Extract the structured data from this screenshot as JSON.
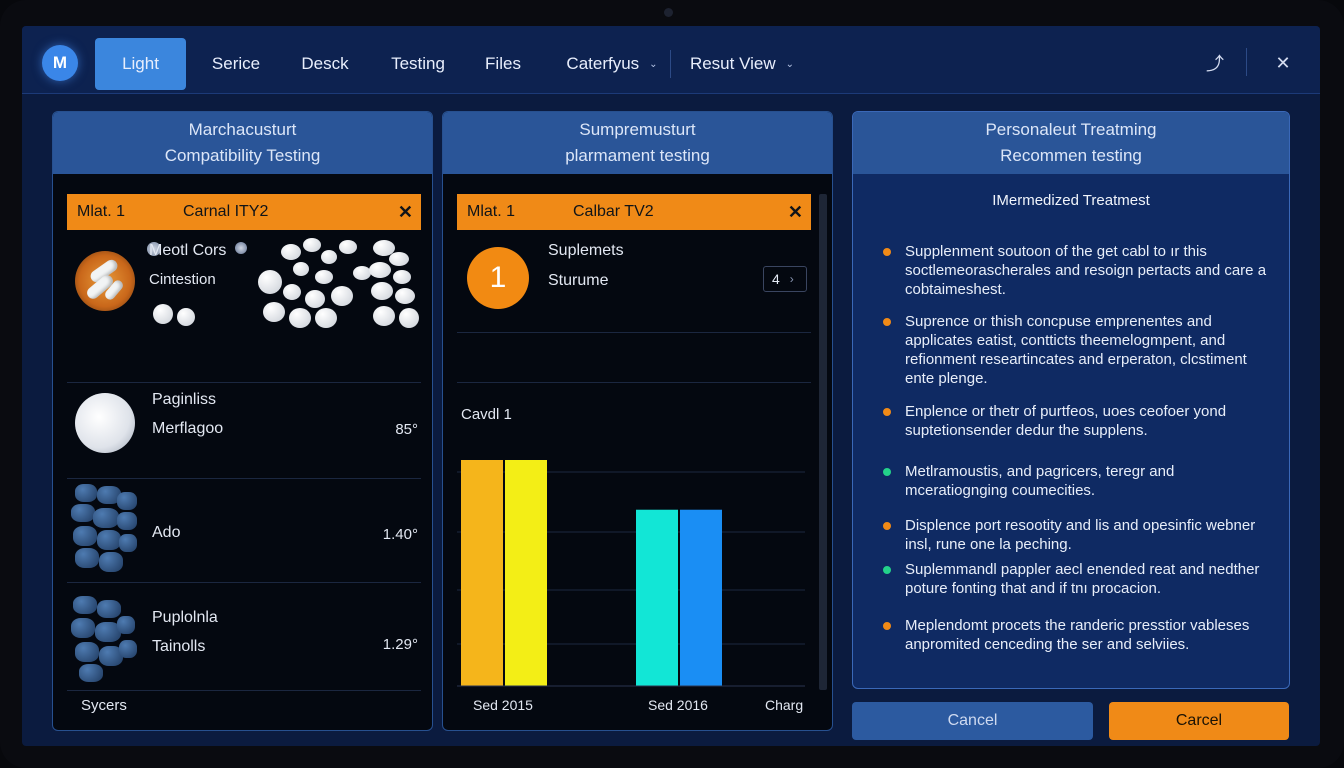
{
  "nav": {
    "logo": "M",
    "tabs": [
      {
        "label": "Light"
      },
      {
        "label": "Serice"
      },
      {
        "label": "Desck"
      },
      {
        "label": "Testing"
      },
      {
        "label": "Files"
      },
      {
        "label": "Caterfyus"
      },
      {
        "label": "Resut View"
      }
    ],
    "pin_icon": "pin-icon",
    "close_icon": "close-icon"
  },
  "panel1": {
    "title_line1": "Marchacusturt",
    "title_line2": "Compatibility Testing",
    "chip_key": "Mlat. 1",
    "chip_value": "Carnal ITY2",
    "rows": [
      {
        "line1": "Meotl Cors",
        "line2": "Cintestion",
        "value": ""
      },
      {
        "line1": "Paginliss",
        "line2": "Merflagoo",
        "value": "85°"
      },
      {
        "line1": "Ado",
        "line2": "",
        "value": "1.40°"
      },
      {
        "line1": "Puplolnla",
        "line2": "Tainolls",
        "value": "1.29°"
      }
    ],
    "footer": "Sycers"
  },
  "panel2": {
    "title_line1": "Sumpremusturt",
    "title_line2": "plarmament testing",
    "chip_key": "Mlat. 1",
    "chip_value": "Calbar TV2",
    "badge": "1",
    "info_line1": "Suplemets",
    "info_line2": "Sturume",
    "pager": "4",
    "section_label": "Cavdl 1",
    "chart_labels": [
      "Sed 2015",
      "Sed 2016",
      "Charg"
    ]
  },
  "chart_data": {
    "type": "bar",
    "categories": [
      "Sed 2015",
      "Sed 2016"
    ],
    "series": [
      {
        "values": [
          100,
          78
        ],
        "color": "#f5b51b"
      },
      {
        "values": [
          100,
          78
        ],
        "color": "#f3ee16"
      }
    ],
    "colors_by_category": {
      "Sed 2015": [
        "#f5b51b",
        "#f3ee16"
      ],
      "Sed 2016": [
        "#12e6d6",
        "#1a8ef4"
      ]
    },
    "ylim": [
      0,
      100
    ],
    "xlabel": "",
    "ylabel": "",
    "grid": true
  },
  "panel3": {
    "title_line1": "Personaleut Treatming",
    "title_line2": "Recommen testing",
    "subtitle": "IMermedized Treatmest",
    "items": [
      {
        "text": "Supplenment soutoon of the get cabl to ır this soctlemeorascherales and resoign pertacts and care a cobtaimeshest.",
        "color": "#f08a17"
      },
      {
        "text": "Suprence or thish concpuse emprenentes and applicates eatist, contticts theemelogmpent, and refionment researtincates and erperaton, clcstiment ente plenge.",
        "color": "#f08a17"
      },
      {
        "text": "Enplence or thetr of purtfeos, uoes ceofoer yond suptetionsender dedur the supplens.",
        "color": "#f08a17"
      },
      {
        "text": "Metlramoustis, and pagricers, teregr and mceratiognging coumecities.",
        "color": "#23d28a"
      },
      {
        "text": "Displence port resootity and lis and opesinfic webner insl, rune one la peching.",
        "color": "#f08a17"
      },
      {
        "text": "Suplemmandl pappler aecl enended reat and nedther poture fonting that and if tnı procacion.",
        "color": "#23d28a"
      },
      {
        "text": "Meplendomt procets the randeric presstior vableses anpromited cenceding the ser and selviies.",
        "color": "#f08a17"
      }
    ]
  },
  "buttons": {
    "secondary": "Cancel",
    "primary": "Carcel"
  },
  "colors": {
    "accent_blue": "#3b86dd",
    "accent_orange": "#f08a17",
    "background": "#0b1b3f"
  }
}
